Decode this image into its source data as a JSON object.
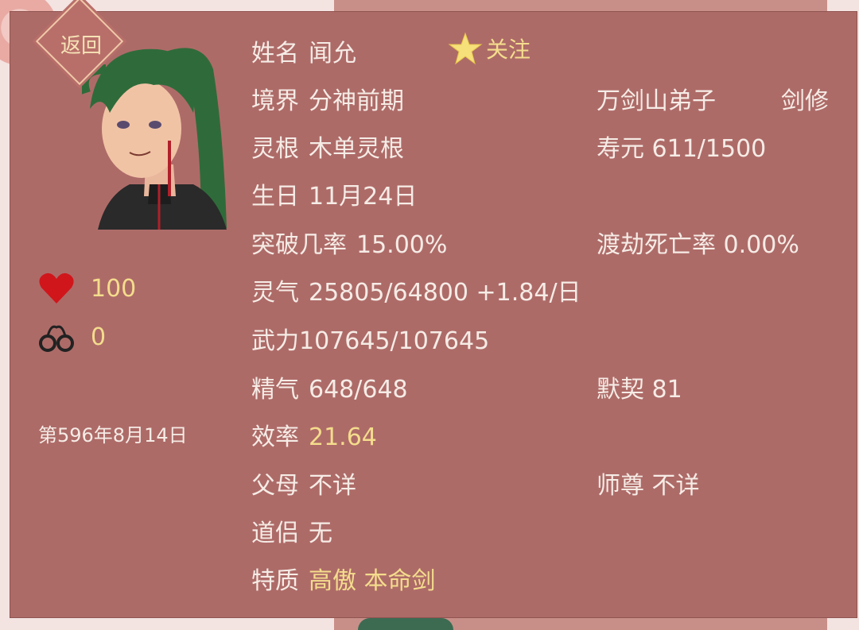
{
  "back_label": "返回",
  "hp": "100",
  "shackles": "0",
  "game_date": "第596年8月14日",
  "follow_label": "关注",
  "colors": {
    "panel": "#ad6b68",
    "highlight": "#f4dc8c",
    "text": "#f6ece6",
    "heart": "#d0161b"
  },
  "icons": {
    "hp": "heart-icon",
    "shackle": "handcuffs-icon",
    "follow": "star-icon"
  },
  "left": {
    "name_label": "姓名",
    "name": "闻允",
    "realm_label": "境界",
    "realm": "分神前期",
    "root_label": "灵根",
    "root": "木单灵根",
    "birthday_label": "生日",
    "birthday": "11月24日",
    "breakthrough_label": "突破几率",
    "breakthrough": "15.00%",
    "qi_label": "灵气",
    "qi": "25805/64800 +1.84/日",
    "force_label": "武力",
    "force": "107645/107645",
    "essence_label": "精气",
    "essence": "648/648",
    "efficiency_label": "效率",
    "efficiency": "21.64",
    "parents_label": "父母",
    "parents": "不详",
    "partner_label": "道侣",
    "partner": "无",
    "traits_label": "特质",
    "trait_1": "高傲",
    "trait_2": "本命剑"
  },
  "right": {
    "sect": "万剑山弟子",
    "role": "剑修",
    "lifespan_label": "寿元",
    "lifespan": "611/1500",
    "tribulation_label": "渡劫死亡率",
    "tribulation": "0.00%",
    "bond_label": "默契",
    "bond": "81",
    "master_label": "师尊",
    "master": "不详"
  }
}
